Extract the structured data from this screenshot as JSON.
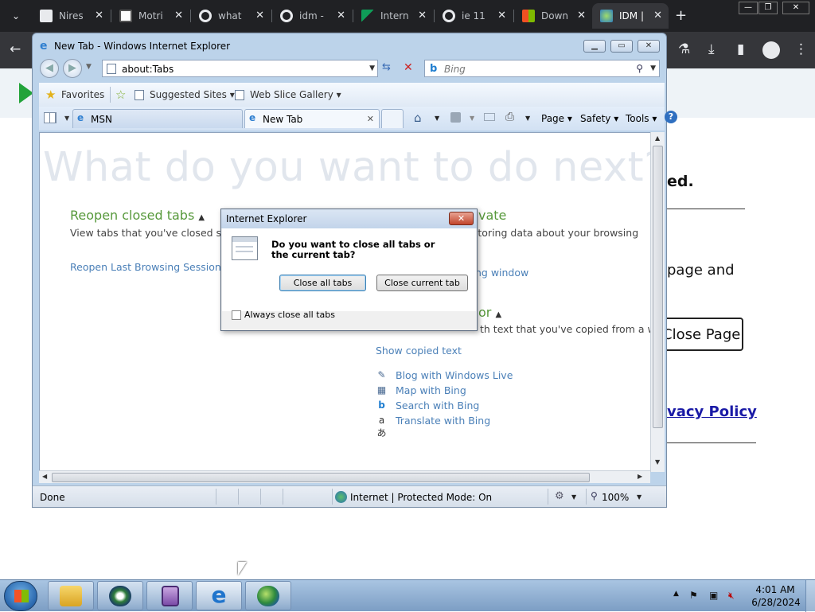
{
  "chrome": {
    "tabs": [
      {
        "label": "Nires",
        "favicon": "newspaper-icon",
        "color": "#e8eaed"
      },
      {
        "label": "Motri",
        "favicon": "site-icon",
        "color": "#ffffff"
      },
      {
        "label": "what",
        "favicon": "google-icon",
        "color": "#4285f4"
      },
      {
        "label": "idm -",
        "favicon": "google-icon",
        "color": "#4285f4"
      },
      {
        "label": "Intern",
        "favicon": "green-flag-icon",
        "color": "#0f9d58"
      },
      {
        "label": "ie 11",
        "favicon": "google-icon",
        "color": "#4285f4"
      },
      {
        "label": "Down",
        "favicon": "microsoft-icon",
        "color": "#f25022"
      },
      {
        "label": "IDM |",
        "favicon": "idm-icon",
        "color": "#3aa757"
      }
    ],
    "new_tab": "+",
    "window_controls": [
      "—",
      "❐",
      "✕"
    ]
  },
  "behind_page": {
    "heading_fragment": "ed.",
    "text_fragment": "page and",
    "button_fragment": "Close Page",
    "link_fragment": "vacy Policy"
  },
  "ie": {
    "title": "New Tab - Windows Internet Explorer",
    "address": "about:Tabs",
    "search_placeholder": "Bing",
    "favorites_label": "Favorites",
    "suggested_sites": "Suggested Sites",
    "web_slice": "Web Slice Gallery",
    "tabs": [
      {
        "label": "MSN"
      },
      {
        "label": "New Tab"
      }
    ],
    "commands": {
      "page": "Page",
      "safety": "Safety",
      "tools": "Tools"
    },
    "content": {
      "headline": "What do you want to do next?",
      "reopen_title": "Reopen closed tabs",
      "reopen_desc": "View tabs that you've closed since",
      "reopen_link": "Reopen Last Browsing Session",
      "private_title": "vate",
      "private_desc": "t storing data about your browsing",
      "private_link": "sing window",
      "accel_title": "or",
      "accel_desc": "th text that you've copied from a we",
      "show_copied": "Show copied text",
      "accelerators": [
        {
          "icon": "blog-icon",
          "label": "Blog with Windows Live"
        },
        {
          "icon": "map-icon",
          "label": "Map with Bing"
        },
        {
          "icon": "bing-icon",
          "label": "Search with Bing"
        },
        {
          "icon": "translate-icon",
          "label": "Translate with Bing"
        }
      ]
    },
    "status": {
      "left": "Done",
      "zone": "Internet | Protected Mode: On",
      "zoom": "100%"
    }
  },
  "dialog": {
    "title": "Internet Explorer",
    "question": "Do you want to close all tabs or the current tab?",
    "close_all": "Close all tabs",
    "close_current": "Close current tab",
    "checkbox_label": "Always close all tabs",
    "checkbox_checked": false
  },
  "taskbar": {
    "apps": [
      "explorer-icon",
      "media-center-icon",
      "purple-app-icon",
      "ie-icon",
      "idm-icon"
    ],
    "time": "4:01 AM",
    "date": "6/28/2024"
  }
}
